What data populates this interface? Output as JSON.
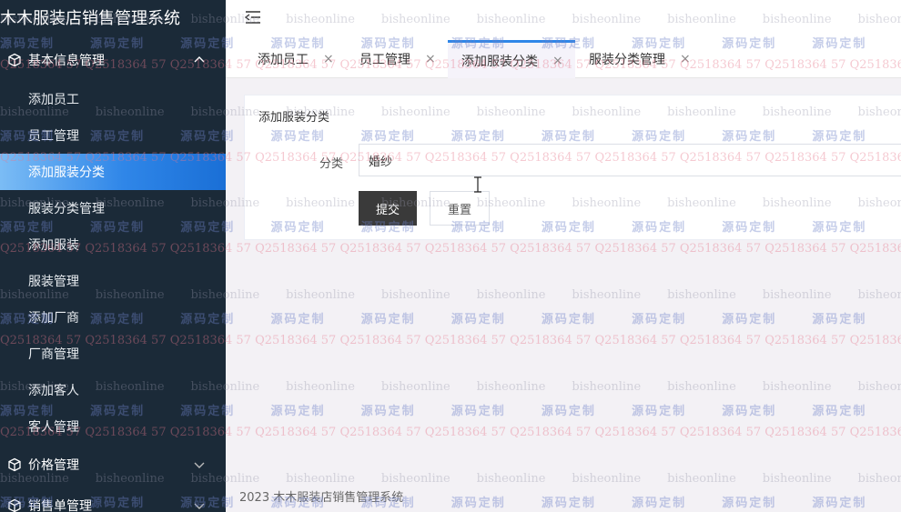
{
  "app": {
    "title": "木木服装店销售管理系统"
  },
  "sidebar": {
    "groups": [
      {
        "label": "基本信息管理",
        "icon": "cube-icon",
        "expanded": true
      },
      {
        "label": "价格管理",
        "icon": "cube-icon",
        "expanded": false
      },
      {
        "label": "销售单管理",
        "icon": "cube-icon",
        "expanded": false
      }
    ],
    "items": [
      {
        "label": "添加员工"
      },
      {
        "label": "员工管理"
      },
      {
        "label": "添加服装分类",
        "active": true
      },
      {
        "label": "服装分类管理"
      },
      {
        "label": "添加服装"
      },
      {
        "label": "服装管理"
      },
      {
        "label": "添加厂商"
      },
      {
        "label": "厂商管理"
      },
      {
        "label": "添加客人"
      },
      {
        "label": "客人管理"
      }
    ]
  },
  "tabs": [
    {
      "label": "添加员工",
      "close": "×"
    },
    {
      "label": "员工管理",
      "close": "×"
    },
    {
      "label": "添加服装分类",
      "close": "×",
      "active": true
    },
    {
      "label": "服装分类管理",
      "close": "×"
    }
  ],
  "form": {
    "title": "添加服装分类",
    "field_label": "分类",
    "field_value": "婚纱",
    "submit_label": "提交",
    "reset_label": "重置"
  },
  "footer": {
    "text": "2023 木木服装店销售管理系统"
  },
  "watermark": {
    "line_a": "bisheonline",
    "line_b": "源码定制",
    "line_c": "Q2518364 57"
  },
  "colors": {
    "sidebar_bg": "#1b2a38",
    "accent": "#2f86e8",
    "submit_bg": "#3a3a3a"
  }
}
